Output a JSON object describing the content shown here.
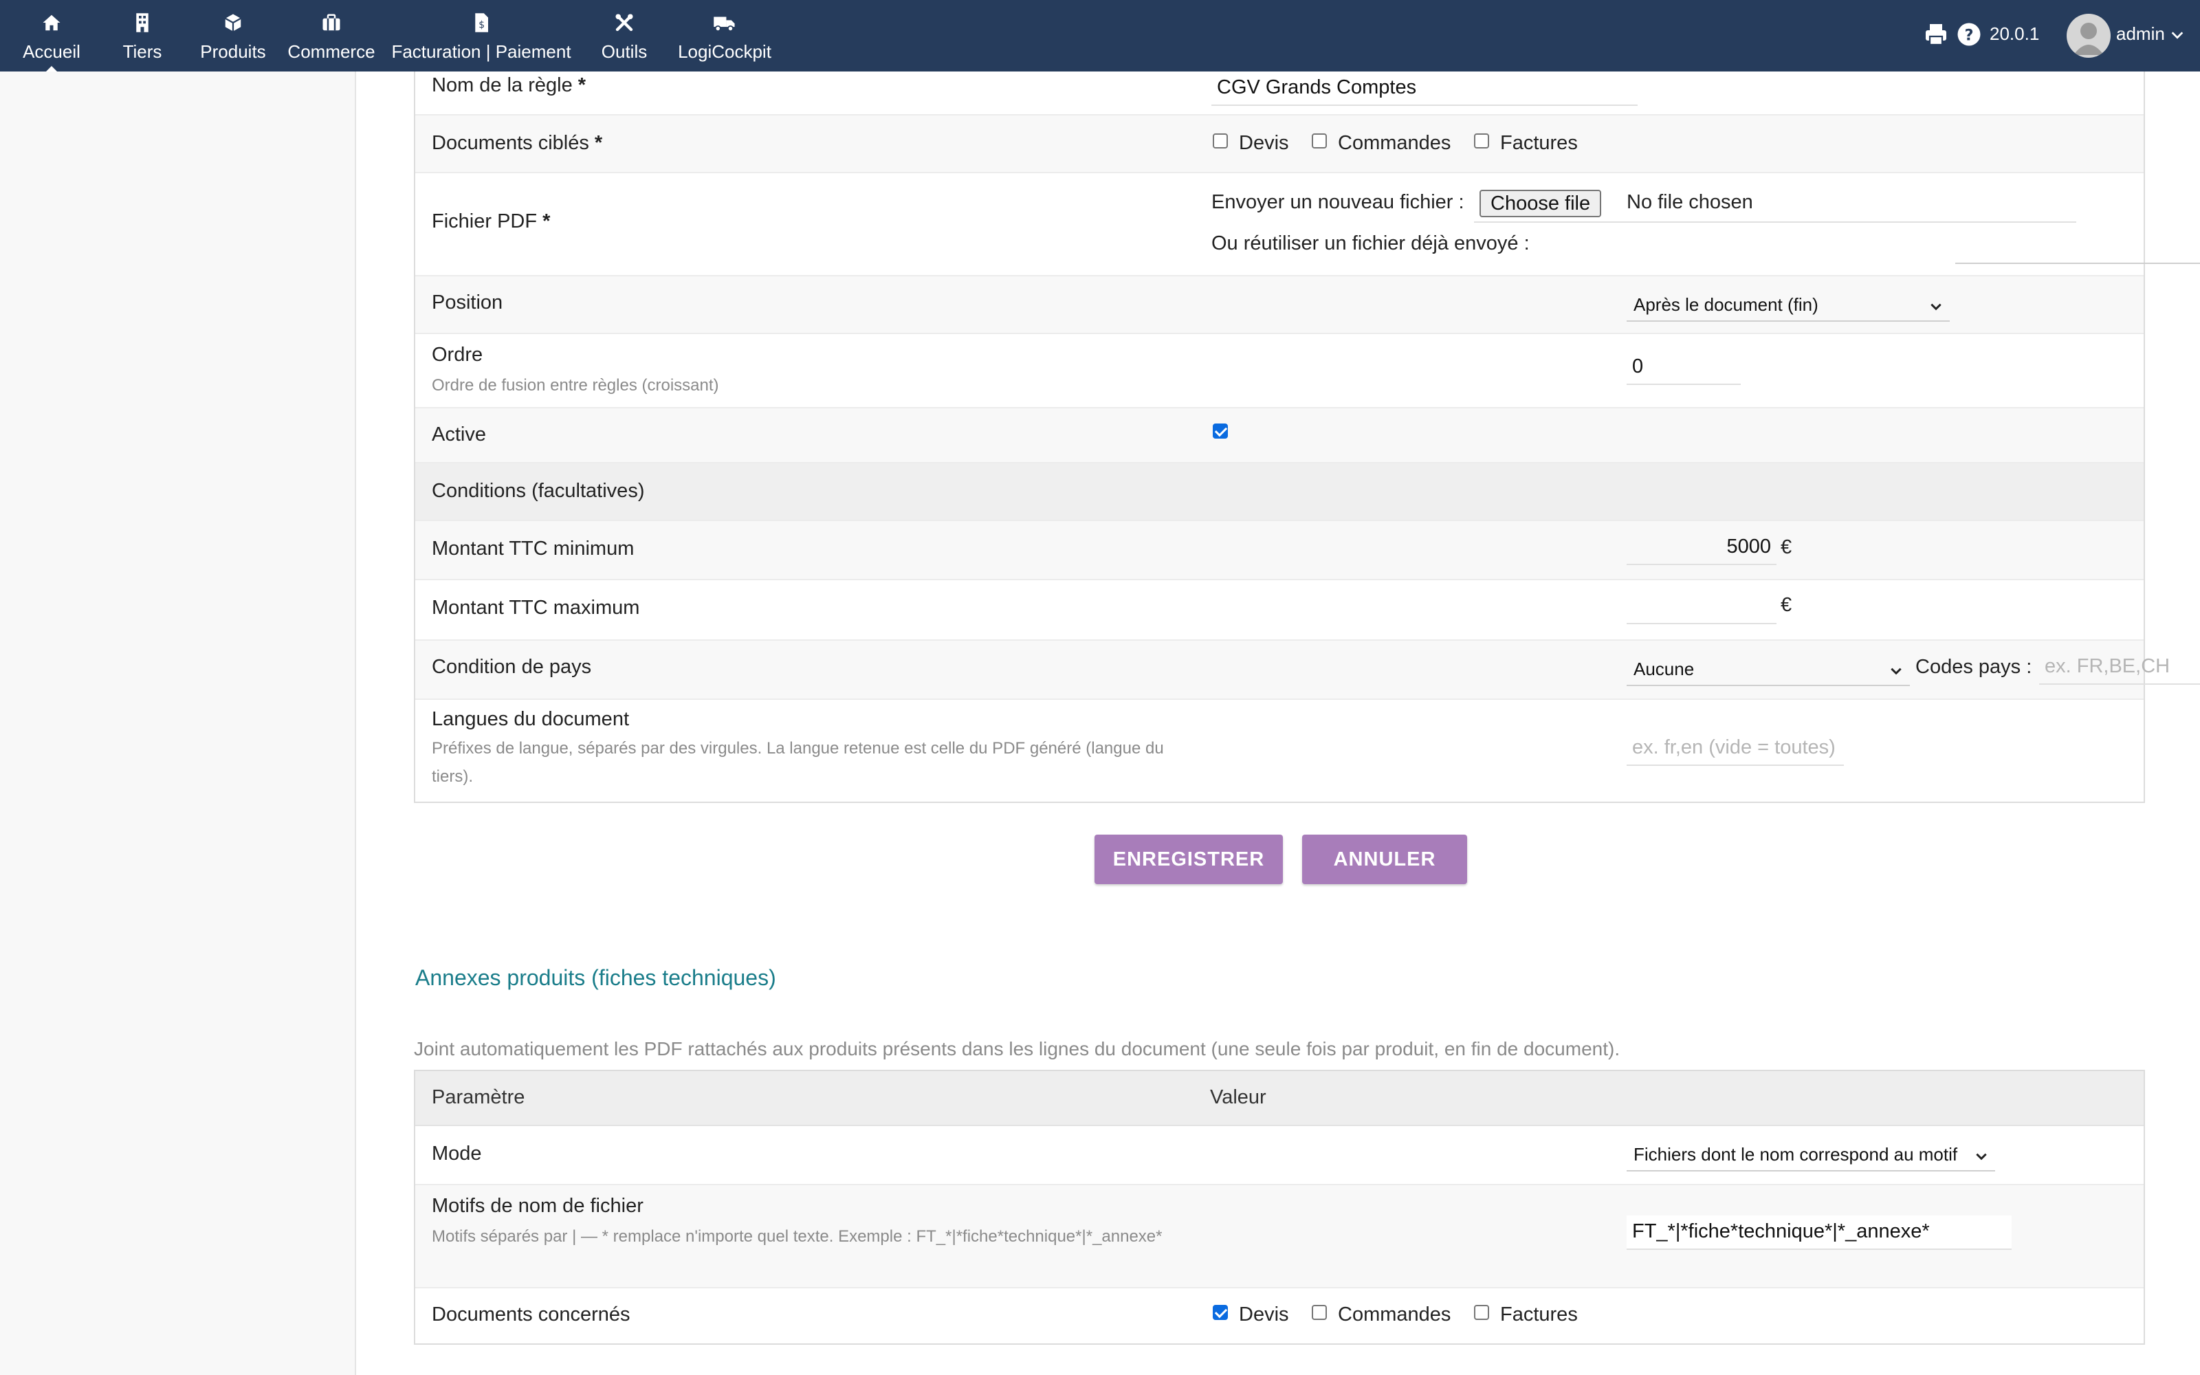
{
  "nav": {
    "items": [
      {
        "label": "Accueil",
        "icon": "home-icon"
      },
      {
        "label": "Tiers",
        "icon": "building-icon"
      },
      {
        "label": "Produits",
        "icon": "cube-icon"
      },
      {
        "label": "Commerce",
        "icon": "briefcase-icon"
      },
      {
        "label": "Facturation | Paiement",
        "icon": "invoice-icon"
      },
      {
        "label": "Outils",
        "icon": "tools-icon"
      },
      {
        "label": "LogiCockpit",
        "icon": "truck-icon"
      }
    ],
    "active": "Accueil",
    "version": "20.0.1",
    "user": "admin"
  },
  "rule_form": {
    "name": {
      "label": "Nom de la règle",
      "required": "*",
      "value": "CGV Grands Comptes"
    },
    "documents": {
      "label": "Documents ciblés",
      "required": "*",
      "options": [
        {
          "label": "Devis",
          "checked": false
        },
        {
          "label": "Commandes",
          "checked": false
        },
        {
          "label": "Factures",
          "checked": false
        }
      ]
    },
    "pdf": {
      "label": "Fichier PDF",
      "required": "*",
      "upload_label": "Envoyer un nouveau fichier :",
      "choose_button": "Choose file",
      "no_file": "No file chosen",
      "reuse_label": "Ou réutiliser un fichier déjà envoyé :",
      "reuse_value": ""
    },
    "position": {
      "label": "Position",
      "value": "Après le document (fin)"
    },
    "order": {
      "label": "Ordre",
      "hint": "Ordre de fusion entre règles (croissant)",
      "value": "0"
    },
    "active": {
      "label": "Active",
      "checked": true
    },
    "conditions_header": "Conditions (facultatives)",
    "min_amount": {
      "label": "Montant TTC minimum",
      "value": "5000",
      "unit": "€"
    },
    "max_amount": {
      "label": "Montant TTC maximum",
      "value": "",
      "unit": "€"
    },
    "country": {
      "label": "Condition de pays",
      "value": "Aucune",
      "codes_label": "Codes pays :",
      "codes_placeholder": "ex. FR,BE,CH"
    },
    "languages": {
      "label": "Langues du document",
      "hint": "Préfixes de langue, séparés par des virgules. La langue retenue est celle du PDF généré (langue du tiers).",
      "placeholder": "ex. fr,en (vide = toutes)"
    },
    "save_button": "ENREGISTRER",
    "cancel_button": "ANNULER"
  },
  "annex": {
    "title": "Annexes produits (fiches techniques)",
    "description": "Joint automatiquement les PDF rattachés aux produits présents dans les lignes du document (une seule fois par produit, en fin de document).",
    "col_param": "Paramètre",
    "col_value": "Valeur",
    "mode": {
      "label": "Mode",
      "value": "Fichiers dont le nom correspond au motif"
    },
    "patterns": {
      "label": "Motifs de nom de fichier",
      "hint": "Motifs séparés par | — * remplace n'importe quel texte. Exemple : FT_*|*fiche*technique*|*_annexe*",
      "value": "FT_*|*fiche*technique*|*_annexe*"
    },
    "documents": {
      "label": "Documents concernés",
      "options": [
        {
          "label": "Devis",
          "checked": true
        },
        {
          "label": "Commandes",
          "checked": false
        },
        {
          "label": "Factures",
          "checked": false
        }
      ]
    }
  },
  "colors": {
    "topbar": "#263c5c",
    "button": "#a87dba",
    "section_title": "#1a7d8a",
    "checkbox": "#0a6be0"
  }
}
